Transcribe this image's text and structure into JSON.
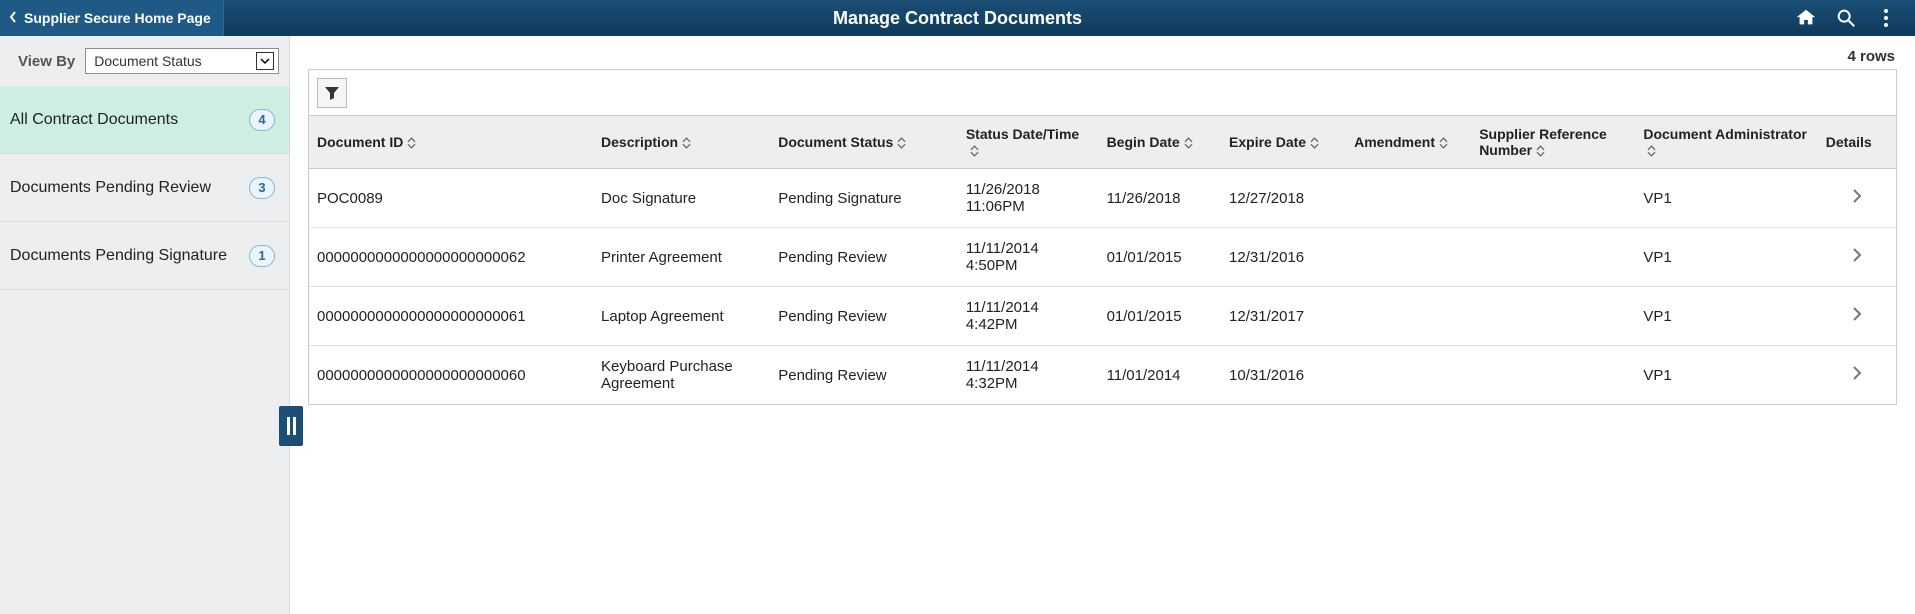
{
  "header": {
    "back_label": "Supplier Secure Home Page",
    "title": "Manage Contract Documents"
  },
  "sidebar": {
    "viewby_label": "View By",
    "viewby_value": "Document Status",
    "items": [
      {
        "label": "All Contract Documents",
        "count": "4",
        "selected": true
      },
      {
        "label": "Documents Pending Review",
        "count": "3",
        "selected": false
      },
      {
        "label": "Documents Pending Signature",
        "count": "1",
        "selected": false
      }
    ]
  },
  "grid": {
    "row_count_label": "4 rows",
    "columns": {
      "document_id": "Document ID",
      "description": "Description",
      "document_status": "Document Status",
      "status_datetime": "Status Date/Time",
      "begin_date": "Begin Date",
      "expire_date": "Expire Date",
      "amendment": "Amendment",
      "supplier_ref": "Supplier Reference Number",
      "admin": "Document Administrator",
      "details": "Details"
    },
    "rows": [
      {
        "document_id": "POC0089",
        "description": "Doc Signature",
        "document_status": "Pending Signature",
        "status_datetime": "11/26/2018 11:06PM",
        "begin_date": "11/26/2018",
        "expire_date": "12/27/2018",
        "amendment": "",
        "supplier_ref": "",
        "admin": "VP1"
      },
      {
        "document_id": "0000000000000000000000062",
        "description": "Printer Agreement",
        "document_status": "Pending Review",
        "status_datetime": "11/11/2014 4:50PM",
        "begin_date": "01/01/2015",
        "expire_date": "12/31/2016",
        "amendment": "",
        "supplier_ref": "",
        "admin": "VP1"
      },
      {
        "document_id": "0000000000000000000000061",
        "description": "Laptop Agreement",
        "document_status": "Pending Review",
        "status_datetime": "11/11/2014 4:42PM",
        "begin_date": "01/01/2015",
        "expire_date": "12/31/2017",
        "amendment": "",
        "supplier_ref": "",
        "admin": "VP1"
      },
      {
        "document_id": "0000000000000000000000060",
        "description": "Keyboard Purchase Agreement",
        "document_status": "Pending Review",
        "status_datetime": "11/11/2014 4:32PM",
        "begin_date": "11/01/2014",
        "expire_date": "10/31/2016",
        "amendment": "",
        "supplier_ref": "",
        "admin": "VP1"
      }
    ]
  }
}
